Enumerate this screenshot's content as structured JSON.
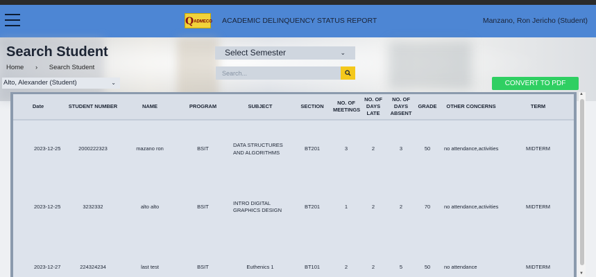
{
  "navbar": {
    "logo_text": "ADMECO",
    "logo_letter": "Q",
    "title": "ACADEMIC DELINQUENCY STATUS REPORT",
    "user": "Manzano, Ron Jericho (Student)"
  },
  "page": {
    "title": "Search Student",
    "breadcrumb": {
      "home": "Home",
      "separator": "›",
      "current": "Search Student"
    }
  },
  "controls": {
    "student_selected": "Alto, Alexander (Student)",
    "semester_selected": "Select Semester",
    "search_placeholder": "Search...",
    "convert_label": "CONVERT TO PDF"
  },
  "table": {
    "headers": {
      "date": "Date",
      "student_number": "STUDENT NUMBER",
      "name": "NAME",
      "program": "PROGRAM",
      "subject": "SUBJECT",
      "section": "SECTION",
      "meetings": "NO. OF MEETINGS",
      "days_late": "NO. OF DAYS LATE",
      "days_absent": "NO. OF DAYS ABSENT",
      "grade": "GRADE",
      "other": "OTHER CONCERNS",
      "term": "TERM"
    },
    "rows": [
      {
        "date": "2023-12-25",
        "student_number": "2000222323",
        "name": "mazano ron",
        "program": "BSIT",
        "subject": "DATA STRUCTURES AND ALGORITHMS",
        "section": "BT201",
        "meetings": "3",
        "days_late": "2",
        "days_absent": "3",
        "grade": "50",
        "other": "no attendance,activities",
        "term": "MIDTERM"
      },
      {
        "date": "2023-12-25",
        "student_number": "3232332",
        "name": "alto alto",
        "program": "BSIT",
        "subject": "INTRO DIGITAL GRAPHICS DESIGN",
        "section": "BT201",
        "meetings": "1",
        "days_late": "2",
        "days_absent": "2",
        "grade": "70",
        "other": "no attendance,activities",
        "term": "MIDTERM"
      },
      {
        "date": "2023-12-27",
        "student_number": "224324234",
        "name": "last test",
        "program": "BSIT",
        "subject": "Euthenics 1",
        "section": "BT101",
        "meetings": "2",
        "days_late": "2",
        "days_absent": "5",
        "grade": "50",
        "other": "no attendance",
        "term": "MIDTERM"
      }
    ]
  },
  "icons": {
    "menu": "hamburger-menu-icon",
    "search": "search-icon",
    "chevron": "chevron-down-icon"
  },
  "colors": {
    "navbar": "#4d86d4",
    "convert_button": "#2fcf62",
    "search_button": "#f4c81c",
    "table_frame": "#8b9aad"
  }
}
